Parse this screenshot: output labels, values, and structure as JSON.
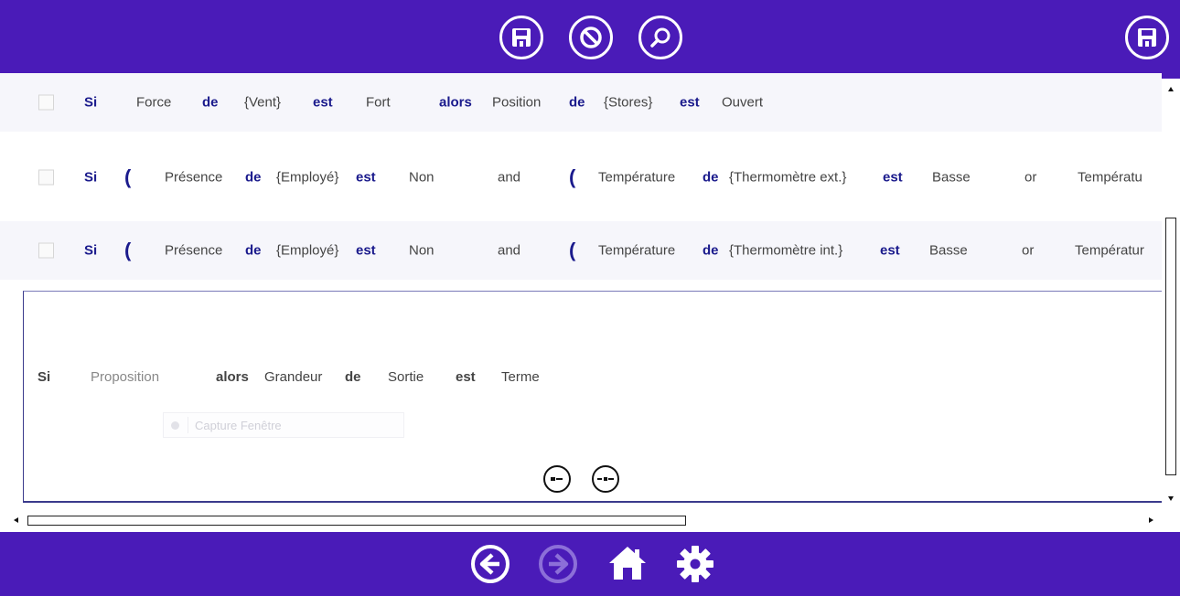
{
  "top_toolbar": {
    "icons": [
      "save-icon",
      "cancel-icon",
      "search-icon",
      "save-icon"
    ]
  },
  "rules": [
    {
      "tokens": [
        {
          "t": "Si",
          "kw": true
        },
        {
          "t": "Force"
        },
        {
          "t": "de",
          "kw": true
        },
        {
          "t": "{Vent}"
        },
        {
          "t": "est",
          "kw": true
        },
        {
          "t": "Fort"
        },
        {
          "t": "alors",
          "kw": true
        },
        {
          "t": "Position"
        },
        {
          "t": "de",
          "kw": true
        },
        {
          "t": "{Stores}"
        },
        {
          "t": "est",
          "kw": true
        },
        {
          "t": "Ouvert"
        }
      ]
    },
    {
      "tokens": [
        {
          "t": "Si",
          "kw": true
        },
        {
          "t": "(",
          "paren": true
        },
        {
          "t": "Présence"
        },
        {
          "t": "de",
          "kw": true
        },
        {
          "t": "{Employé}"
        },
        {
          "t": "est",
          "kw": true
        },
        {
          "t": "Non"
        },
        {
          "t": "and"
        },
        {
          "t": "(",
          "paren": true
        },
        {
          "t": "Température"
        },
        {
          "t": "de",
          "kw": true
        },
        {
          "t": "{Thermomètre ext.}"
        },
        {
          "t": "est",
          "kw": true
        },
        {
          "t": "Basse"
        },
        {
          "t": "or"
        },
        {
          "t": "Températu"
        }
      ]
    },
    {
      "tokens": [
        {
          "t": "Si",
          "kw": true
        },
        {
          "t": "(",
          "paren": true
        },
        {
          "t": "Présence"
        },
        {
          "t": "de",
          "kw": true
        },
        {
          "t": "{Employé}"
        },
        {
          "t": "est",
          "kw": true
        },
        {
          "t": "Non"
        },
        {
          "t": "and"
        },
        {
          "t": "(",
          "paren": true
        },
        {
          "t": "Température"
        },
        {
          "t": "de",
          "kw": true
        },
        {
          "t": "{Thermomètre int.}"
        },
        {
          "t": "est",
          "kw": true
        },
        {
          "t": "Basse"
        },
        {
          "t": "or"
        },
        {
          "t": "Températur"
        }
      ]
    }
  ],
  "editor": {
    "si": "Si",
    "proposition_placeholder": "Proposition",
    "alors": "alors",
    "grandeur": "Grandeur",
    "de": "de",
    "sortie": "Sortie",
    "est": "est",
    "terme": "Terme",
    "capture_label": "Capture Fenêtre"
  },
  "bottom_nav": {
    "icons": [
      "back-icon",
      "forward-icon",
      "home-icon",
      "settings-icon"
    ]
  },
  "colors": {
    "brand": "#4a1bb8",
    "keyword": "#1a1a8c",
    "text": "#444444",
    "disabled_icon": "#8c6fd8"
  }
}
